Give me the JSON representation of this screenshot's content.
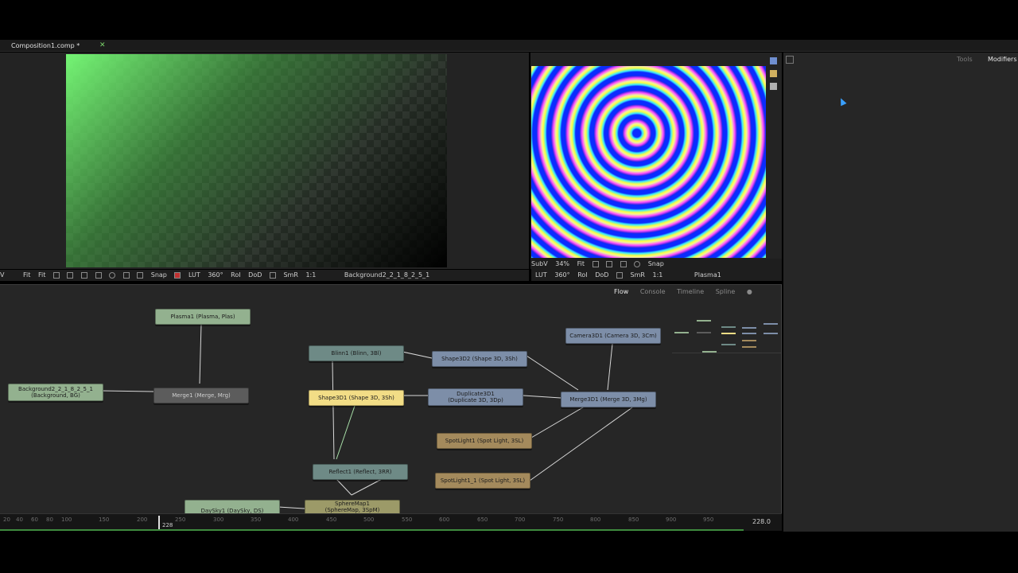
{
  "tab": {
    "title": "Composition1.comp *",
    "close": "✕"
  },
  "side_tabs": {
    "tools": "Tools",
    "modifiers": "Modifiers"
  },
  "viewer1_toolbar": {
    "items": [
      "V",
      "Fit",
      "Fit",
      "Snap",
      "LUT",
      "360°",
      "RoI",
      "DoD",
      "SmR",
      "1:1"
    ],
    "node_name": "Background2_2_1_8_2_5_1"
  },
  "viewer2_top": {
    "subv": "SubV",
    "zoom": "34%",
    "fit": "Fit",
    "snap": "Snap"
  },
  "viewer2_toolbar": {
    "items": [
      "LUT",
      "360°",
      "RoI",
      "DoD",
      "SmR",
      "1:1"
    ],
    "node_name": "Plasma1"
  },
  "flow_tabs": [
    "Flow",
    "Console",
    "Timeline",
    "Spline"
  ],
  "nodes": {
    "plasma1": "Plasma1  (Plasma, Plas)",
    "background": "Background2_2_1_8_2_5_1\n(Background, BG)",
    "merge1": "Merge1  (Merge, Mrg)",
    "blinn1": "Blinn1  (Blinn, 3Bl)",
    "shape3d2": "Shape3D2  (Shape 3D, 3Sh)",
    "shape3d1": "Shape3D1  (Shape 3D, 3Sh)",
    "duplicate": "Duplicate3D1\n(Duplicate 3D, 3Dp)",
    "camera": "Camera3D1  (Camera 3D, 3Cm)",
    "merge3d": "Merge3D1  (Merge 3D, 3Mg)",
    "spot1": "SpotLight1  (Spot Light, 3SL)",
    "spot2": "SpotLight1_1  (Spot Light, 3SL)",
    "reflect": "Reflect1  (Reflect, 3RR)",
    "spheremap": "SphereMap1\n(SphereMap, 3SpM)",
    "daysky": "DaySky1  (DaySky, DS)"
  },
  "timeline": {
    "ticks": [
      "20",
      "40",
      "60",
      "80",
      "100",
      "150",
      "200",
      "250",
      "300",
      "350",
      "400",
      "450",
      "500",
      "550",
      "600",
      "650",
      "700",
      "750",
      "800",
      "850",
      "900",
      "950"
    ],
    "current": "228",
    "end": "228.0"
  },
  "colors": {
    "accent": "#7bd46a",
    "bg": "#262626"
  }
}
